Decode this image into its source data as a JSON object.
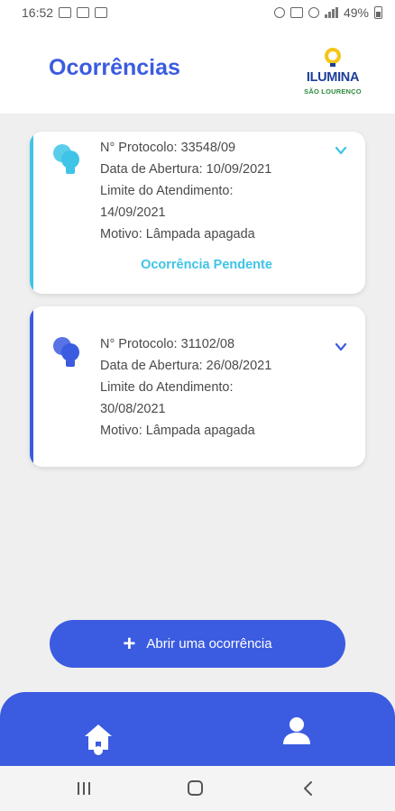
{
  "status_bar": {
    "time": "16:52",
    "battery": "49%"
  },
  "header": {
    "title": "Ocorrências",
    "logo": {
      "word": "ILUMINA",
      "sub": "SÃO LOURENÇO"
    }
  },
  "occurrences": [
    {
      "protocol": "N° Protocolo: 33548/09",
      "opened": "Data de Abertura: 10/09/2021",
      "limit_label": "Limite do Atendimento:",
      "limit_date": "14/09/2021",
      "reason": "Motivo: Lâmpada apagada",
      "status": "Ocorrência Pendente",
      "accent_color": "#3ec4e6"
    },
    {
      "protocol": "N° Protocolo: 31102/08",
      "opened": "Data de Abertura: 26/08/2021",
      "limit_label": "Limite do Atendimento:",
      "limit_date": "30/08/2021",
      "reason": "Motivo: Lâmpada apagada",
      "accent_color": "#3b5be0"
    }
  ],
  "actions": {
    "open_label": "Abrir uma ocorrência"
  },
  "bottom_nav": {
    "items": [
      {
        "icon": "home-icon",
        "active": true
      },
      {
        "icon": "user-icon",
        "active": false
      }
    ]
  },
  "colors": {
    "primary": "#3b5be0",
    "accent": "#3ec4e6"
  }
}
